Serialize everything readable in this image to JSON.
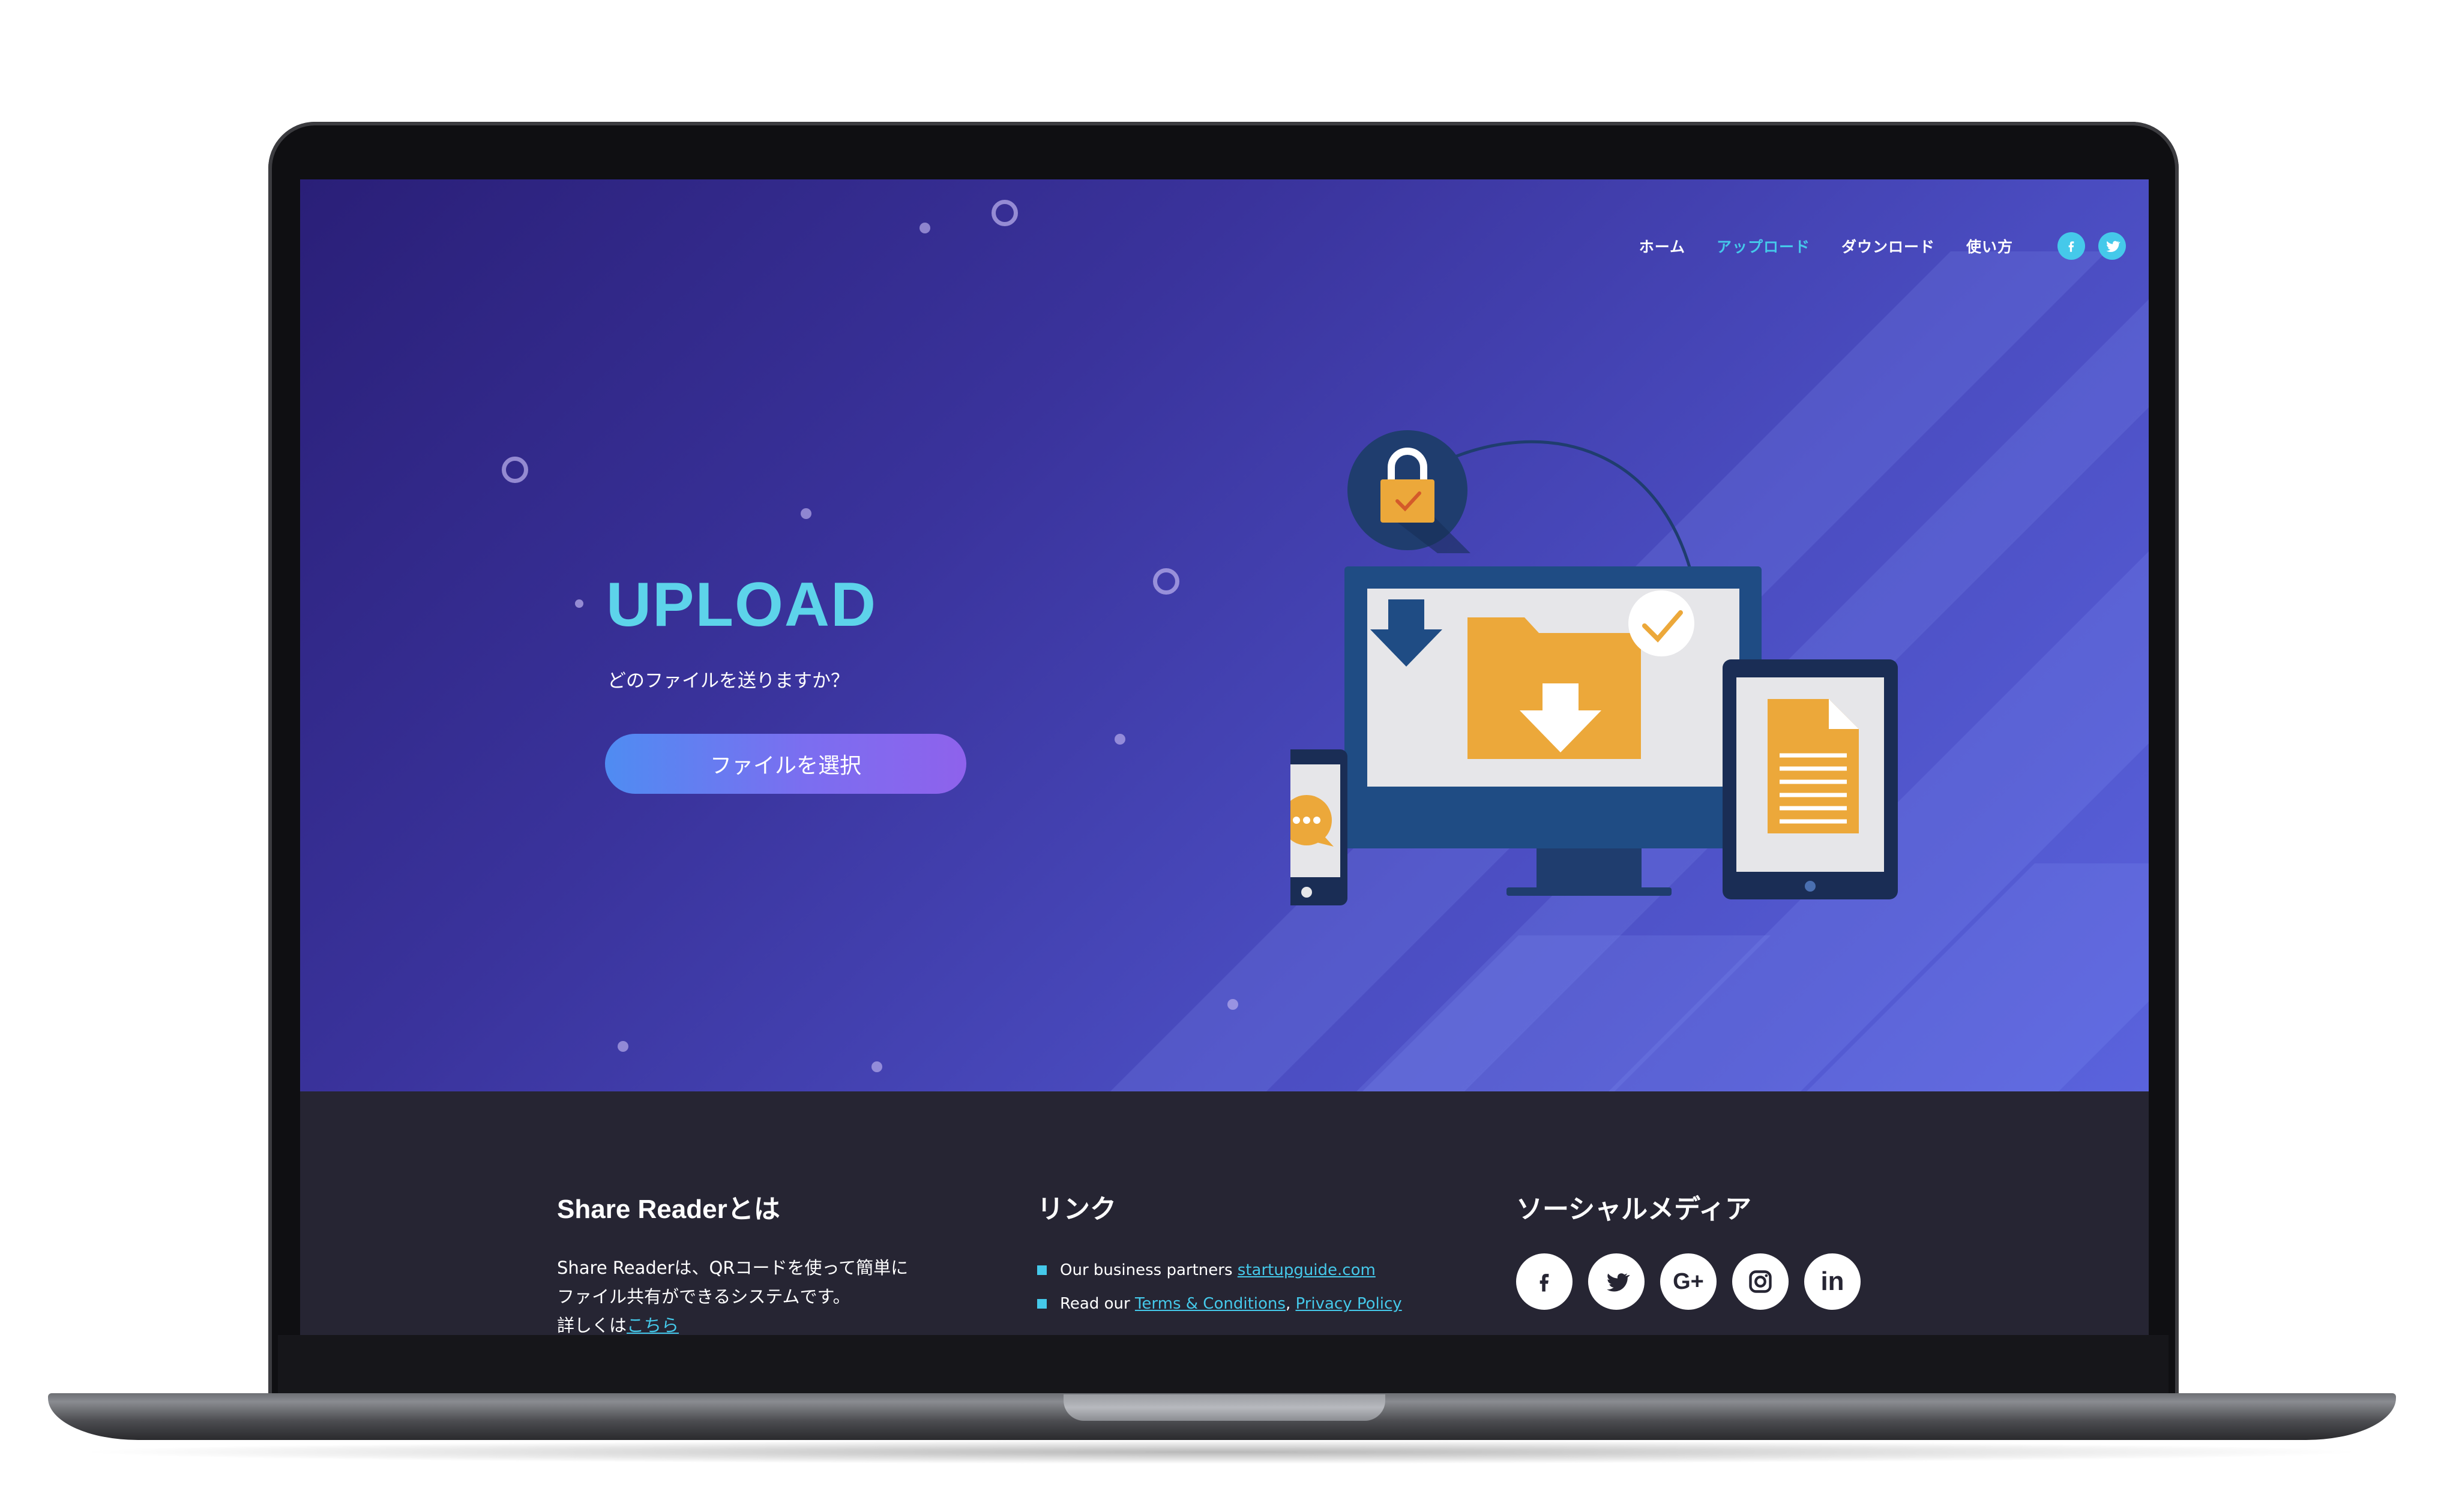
{
  "nav": {
    "items": [
      {
        "label": "ホーム",
        "active": false
      },
      {
        "label": "アップロード",
        "active": true
      },
      {
        "label": "ダウンロード",
        "active": false
      },
      {
        "label": "使い方",
        "active": false
      }
    ],
    "social": [
      "facebook-icon",
      "twitter-icon"
    ],
    "accent_color": "#45c9ea"
  },
  "hero": {
    "title": "UPLOAD",
    "subtitle": "どのファイルを送りますか？",
    "button_label": "ファイルを選択",
    "illustration": [
      "lock-icon",
      "monitor-icon",
      "folder-download-icon",
      "check-icon",
      "phone-chat-icon",
      "tablet-document-icon"
    ]
  },
  "footer": {
    "about": {
      "heading": "Share Readerとは",
      "line1": "Share Readerは、QRコードを使って簡単に",
      "line2": "ファイル共有ができるシステムです。",
      "line3_prefix": "詳しくは",
      "line3_link": "こちら"
    },
    "links": {
      "heading": "リンク",
      "item1_prefix": "Our business partners ",
      "item1_link": "startupguide.com",
      "item2_prefix": "Read our ",
      "item2_link1": "Terms & Conditions",
      "item2_sep": ", ",
      "item2_link2": "Privacy Policy"
    },
    "social": {
      "heading": "ソーシャルメディア",
      "icons": [
        "facebook-icon",
        "twitter-icon",
        "google-plus-icon",
        "instagram-icon",
        "linkedin-icon"
      ],
      "google_label": "G+",
      "linkedin_label": "in"
    },
    "background": "#262533"
  }
}
